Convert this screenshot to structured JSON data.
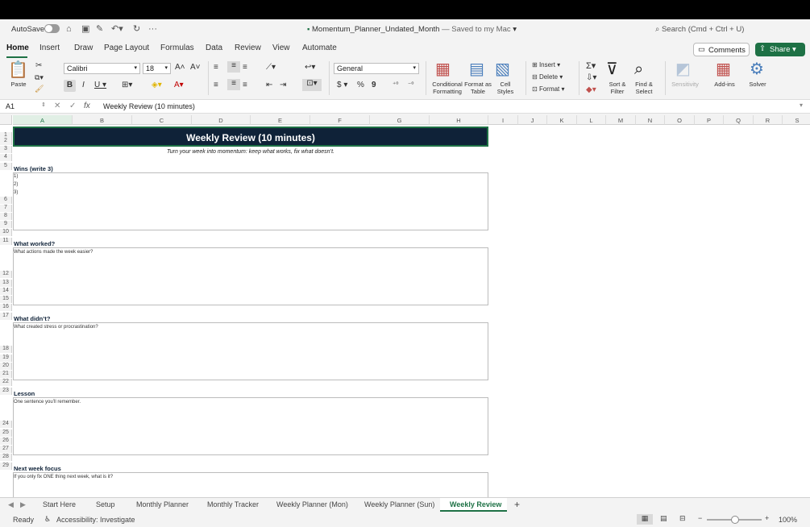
{
  "title_bar": {
    "autosave_label": "AutoSave",
    "file_name": "Momentum_Planner_Undated_Month",
    "saved_status": " — Saved to my Mac",
    "search_placeholder": "Search (Cmd + Ctrl + U)"
  },
  "menu_tabs": [
    "Home",
    "Insert",
    "Draw",
    "Page Layout",
    "Formulas",
    "Data",
    "Review",
    "View",
    "Automate"
  ],
  "buttons": {
    "comments": "Comments",
    "share": "Share"
  },
  "ribbon": {
    "paste": "Paste",
    "font_name": "Calibri",
    "font_size": "18",
    "number_format": "General",
    "conditional_formatting": "Conditional Formatting",
    "format_as_table": "Format as Table",
    "cell_styles": "Cell Styles",
    "insert": "Insert",
    "delete": "Delete",
    "format": "Format",
    "sort_filter": "Sort & Filter",
    "find_select": "Find & Select",
    "sensitivity": "Sensitivity",
    "add_ins": "Add-ins",
    "solver": "Solver"
  },
  "formula_bar": {
    "name_box": "A1",
    "fx": "fx",
    "content": "Weekly Review (10 minutes)"
  },
  "columns": [
    "A",
    "B",
    "C",
    "D",
    "E",
    "F",
    "G",
    "H",
    "I",
    "J",
    "K",
    "L",
    "M",
    "N",
    "O",
    "P",
    "Q",
    "R",
    "S"
  ],
  "rows": [
    "1",
    "2",
    "3",
    "4",
    "5",
    "6",
    "7",
    "8",
    "9",
    "10",
    "11",
    "12",
    "13",
    "14",
    "15",
    "16",
    "17",
    "18",
    "19",
    "20",
    "21",
    "22",
    "23",
    "24",
    "25",
    "26",
    "27",
    "28",
    "29"
  ],
  "sheet": {
    "banner": "Weekly Review (10 minutes)",
    "subtitle": "Turn your week into momentum: keep what works, fix what doesn’t.",
    "wins_title": "Wins (write 3)",
    "wins_items": [
      "1)",
      "2)",
      "3)"
    ],
    "worked_title": "What worked?",
    "worked_prompt": "What actions made the week easier?",
    "didnt_title": "What didn’t?",
    "didnt_prompt": "What created stress or procrastination?",
    "lesson_title": "Lesson",
    "lesson_prompt": "One sentence you’ll remember.",
    "focus_title": "Next week focus",
    "focus_prompt": "If you only fix ONE thing next week, what is it?"
  },
  "sheet_tabs": [
    "Start Here",
    "Setup",
    "Monthly Planner",
    "Monthly Tracker",
    "Weekly Planner (Mon)",
    "Weekly Planner (Sun)",
    "Weekly Review"
  ],
  "active_sheet": "Weekly Review",
  "status": {
    "ready": "Ready",
    "accessibility": "Accessibility: Investigate",
    "zoom": "100%"
  },
  "colors": {
    "accent_green": "#1e7145",
    "banner_navy": "#0f2238"
  }
}
